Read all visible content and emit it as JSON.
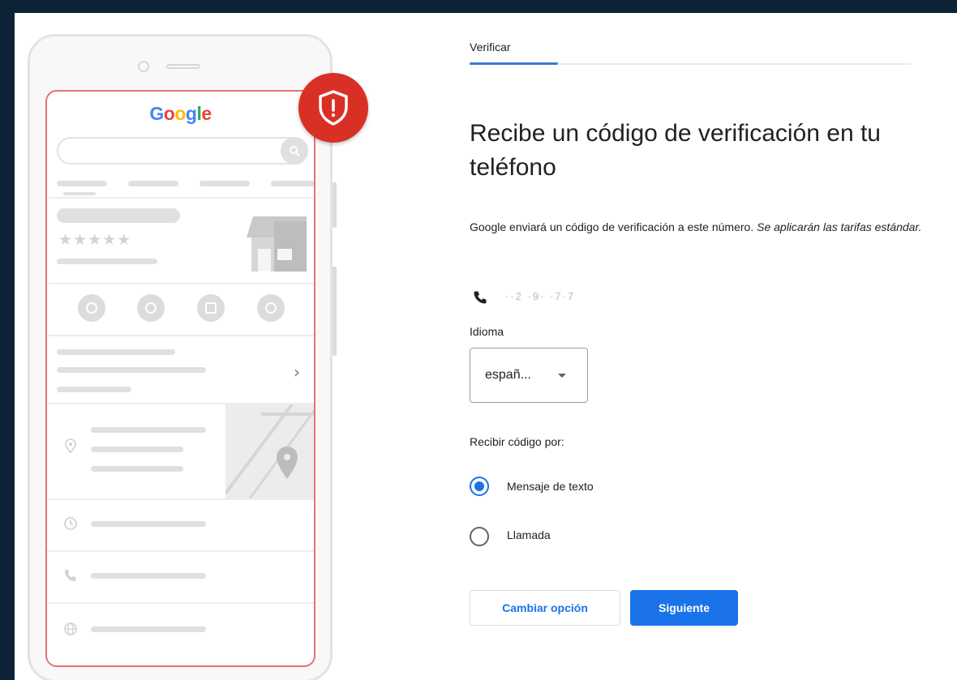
{
  "phone_mockup": {
    "logo_letters": [
      {
        "ch": "G",
        "color": "#4285f4"
      },
      {
        "ch": "o",
        "color": "#ea4335"
      },
      {
        "ch": "o",
        "color": "#fbbc05"
      },
      {
        "ch": "g",
        "color": "#4285f4"
      },
      {
        "ch": "l",
        "color": "#34a853"
      },
      {
        "ch": "e",
        "color": "#ea4335"
      }
    ],
    "rating_stars": "★★★★★",
    "chevron": "›",
    "icons": [
      "phone-icon",
      "directions-icon",
      "bookmark-icon",
      "website-icon",
      "location-pin-icon",
      "clock-icon",
      "globe-icon",
      "search-icon",
      "store-icon",
      "shield-alert-icon"
    ]
  },
  "verify": {
    "tab_label": "Verificar",
    "title": "Recibe un código de verificación en tu teléfono",
    "description": "Google enviará un código de verificación a este número.",
    "description_italic": "Se aplicarán las tarifas estándar.",
    "phone_number": "··2 ·9· ·7·7",
    "language_label": "Idioma",
    "language_value": "españ...",
    "receive_label": "Recibir código por:",
    "options": [
      {
        "label": "Mensaje de texto",
        "selected": true
      },
      {
        "label": "Llamada",
        "selected": false
      }
    ],
    "change_option_button": "Cambiar opción",
    "next_button": "Siguiente"
  },
  "colors": {
    "accent": "#1a73e8",
    "alert": "#d93025",
    "background": "#0d2236"
  }
}
